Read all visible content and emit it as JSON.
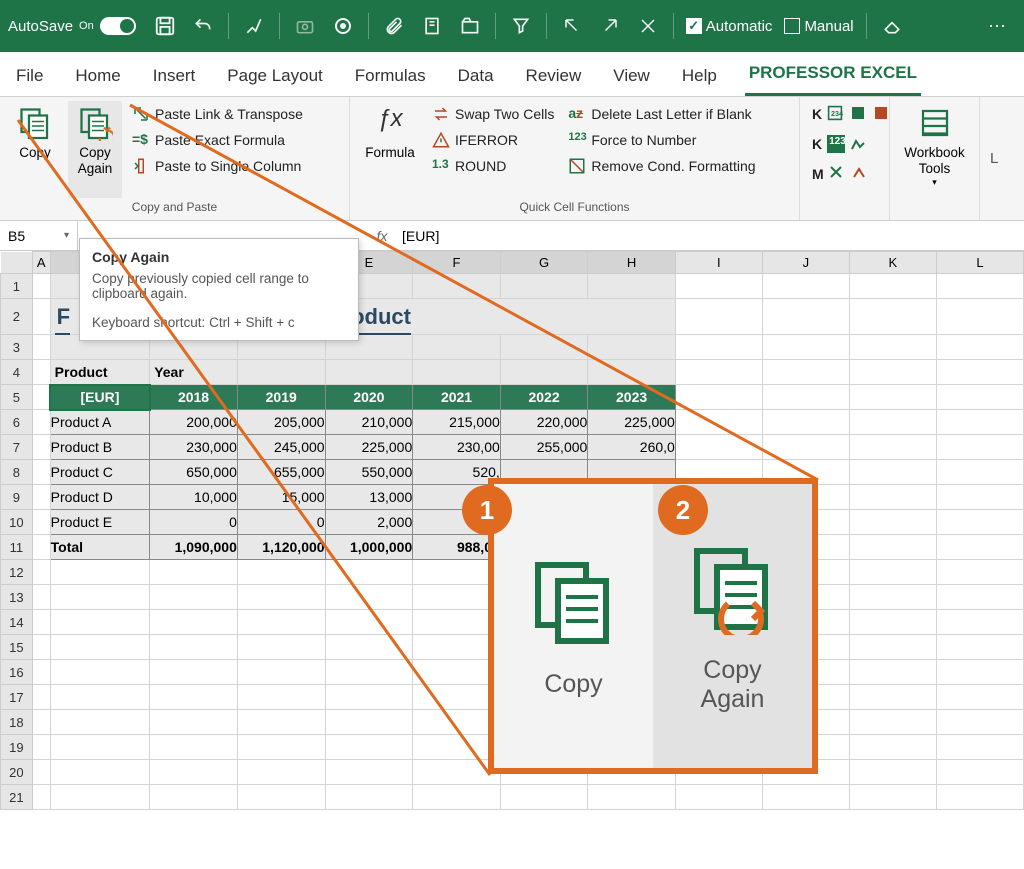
{
  "titlebar": {
    "autosave": "AutoSave",
    "autosave_state": "On",
    "automatic": "Automatic",
    "manual": "Manual"
  },
  "tabs": [
    "File",
    "Home",
    "Insert",
    "Page Layout",
    "Formulas",
    "Data",
    "Review",
    "View",
    "Help",
    "PROFESSOR EXCEL"
  ],
  "active_tab_index": 9,
  "ribbon": {
    "copy": "Copy",
    "copy_again": "Copy\nAgain",
    "paste_link_transpose": "Paste Link & Transpose",
    "paste_exact_formula": "Paste Exact Formula",
    "paste_single_column": "Paste to Single Column",
    "group1": "Copy and Paste",
    "formula": "Formula",
    "swap_two_cells": "Swap Two Cells",
    "iferror": "IFERROR",
    "round": "ROUND",
    "delete_last_letter": "Delete Last Letter if Blank",
    "force_to_number": "Force to Number",
    "remove_cond_fmt": "Remove Cond. Formatting",
    "group2": "Quick Cell Functions",
    "workbook_tools": "Workbook\nTools"
  },
  "tooltip": {
    "title": "Copy Again",
    "body": "Copy previously copied cell range to clipboard again.",
    "shortcut": "Keyboard shortcut: Ctrl + Shift + c"
  },
  "formula_bar": {
    "name": "B5",
    "value": "[EUR]"
  },
  "columns": [
    "A",
    "B",
    "C",
    "D",
    "E",
    "F",
    "G",
    "H",
    "I",
    "J",
    "K",
    "L"
  ],
  "selected_cols": [
    "B",
    "C",
    "D",
    "E",
    "F",
    "G",
    "H"
  ],
  "sheet": {
    "title_partial": "product",
    "product_label": "Product",
    "year_label": "Year",
    "header": [
      "[EUR]",
      "2018",
      "2019",
      "2020",
      "2021",
      "2022",
      "2023"
    ],
    "rows": [
      [
        "Product A",
        "200,000",
        "205,000",
        "210,000",
        "215,000",
        "220,000",
        "225,000"
      ],
      [
        "Product B",
        "230,000",
        "245,000",
        "225,000",
        "230,00",
        "255,000",
        "260,0"
      ],
      [
        "Product C",
        "650,000",
        "655,000",
        "550,000",
        "520,",
        "",
        ""
      ],
      [
        "Product D",
        "10,000",
        "15,000",
        "13,000",
        "18,0",
        "",
        ""
      ],
      [
        "Product E",
        "0",
        "0",
        "2,000",
        "5,00",
        "",
        ""
      ]
    ],
    "total_label": "Total",
    "total_row": [
      "1,090,000",
      "1,120,000",
      "1,000,000",
      "988,00",
      "",
      ""
    ]
  },
  "callout": {
    "btn1": "Copy",
    "btn2": "Copy\nAgain",
    "badge1": "1",
    "badge2": "2"
  }
}
